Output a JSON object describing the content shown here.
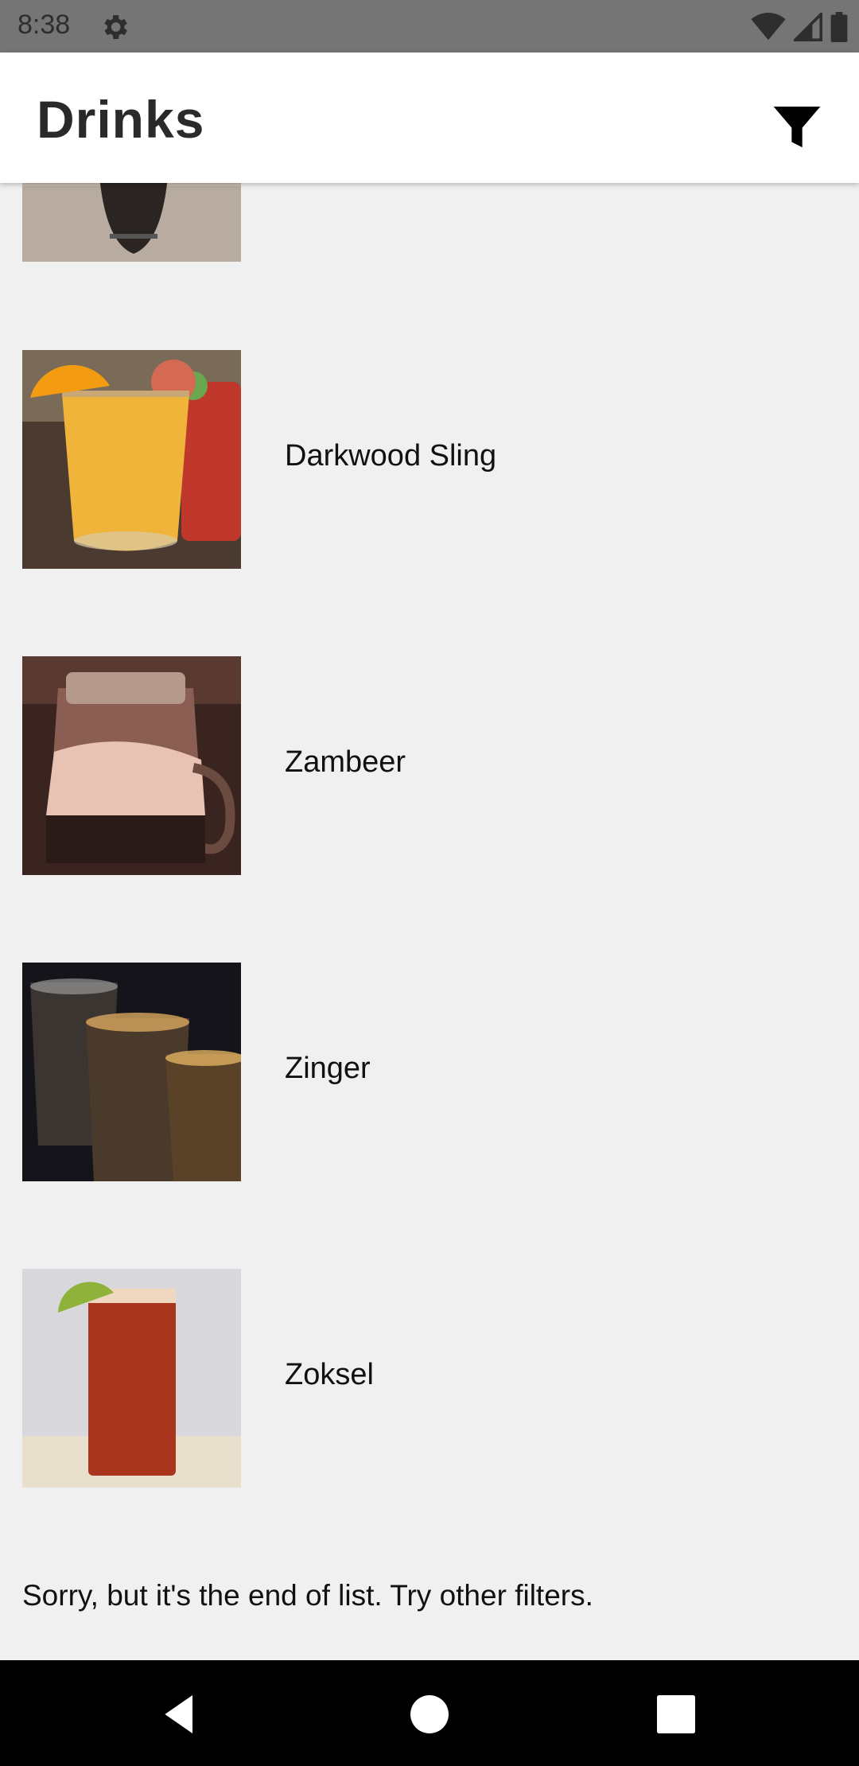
{
  "status_bar": {
    "time": "8:38",
    "icons": [
      "settings-icon",
      "wifi-icon",
      "signal-icon",
      "battery-icon"
    ]
  },
  "app_bar": {
    "title": "Drinks",
    "filter_icon": "filter-icon"
  },
  "drinks": [
    {
      "name": "Darkwood Sling"
    },
    {
      "name": "Zambeer"
    },
    {
      "name": "Zinger"
    },
    {
      "name": "Zoksel"
    }
  ],
  "end_message": "Sorry, but it's the end of list. Try other filters.",
  "nav_bar": {
    "icons": [
      "back-icon",
      "home-icon",
      "recents-icon"
    ]
  },
  "colors": {
    "status_bar": "#757575",
    "app_bar": "#ffffff",
    "background": "#f0f0f0",
    "nav_bar": "#000000"
  }
}
